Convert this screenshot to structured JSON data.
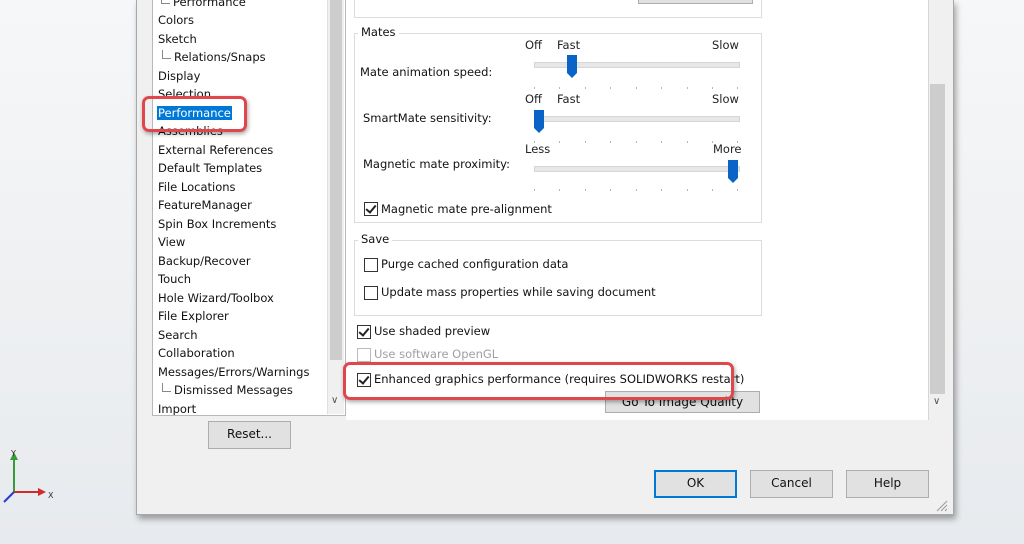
{
  "tree": {
    "items": [
      {
        "label": "Performance",
        "indent": true
      },
      {
        "label": "Colors",
        "indent": false
      },
      {
        "label": "Sketch",
        "indent": false
      },
      {
        "label": "Relations/Snaps",
        "indent": true
      },
      {
        "label": "Display",
        "indent": false
      },
      {
        "label": "Selection",
        "indent": false
      },
      {
        "label": "Performance",
        "indent": false,
        "selected": true
      },
      {
        "label": "Assemblies",
        "indent": false
      },
      {
        "label": "External References",
        "indent": false
      },
      {
        "label": "Default Templates",
        "indent": false
      },
      {
        "label": "File Locations",
        "indent": false
      },
      {
        "label": "FeatureManager",
        "indent": false
      },
      {
        "label": "Spin Box Increments",
        "indent": false
      },
      {
        "label": "View",
        "indent": false
      },
      {
        "label": "Backup/Recover",
        "indent": false
      },
      {
        "label": "Touch",
        "indent": false
      },
      {
        "label": "Hole Wizard/Toolbox",
        "indent": false
      },
      {
        "label": "File Explorer",
        "indent": false
      },
      {
        "label": "Search",
        "indent": false
      },
      {
        "label": "Collaboration",
        "indent": false
      },
      {
        "label": "Messages/Errors/Warnings",
        "indent": false
      },
      {
        "label": "Dismissed Messages",
        "indent": true
      },
      {
        "label": "Import",
        "indent": false
      }
    ]
  },
  "reset_label": "Reset...",
  "mates": {
    "title": "Mates",
    "animation_label": "Mate animation speed:",
    "animation_off": "Off",
    "animation_fast": "Fast",
    "animation_slow": "Slow",
    "animation_level": 0.2,
    "smartmate_label": "SmartMate sensitivity:",
    "smartmate_off": "Off",
    "smartmate_fast": "Fast",
    "smartmate_slow": "Slow",
    "smartmate_level": 0.0,
    "magnetic_label": "Magnetic mate proximity:",
    "magnetic_less": "Less",
    "magnetic_more": "More",
    "magnetic_level": 1.0,
    "prealign_label": "Magnetic mate pre-alignment",
    "prealign_checked": true
  },
  "save": {
    "title": "Save",
    "purge_label": "Purge cached configuration data",
    "purge_checked": false,
    "update_label": "Update mass properties while saving document",
    "update_checked": false
  },
  "options": {
    "shaded_preview_label": "Use shaded preview",
    "shaded_preview_checked": true,
    "software_opengl_label": "Use software OpenGL",
    "software_opengl_checked": false,
    "enhanced_label": "Enhanced graphics performance (requires SOLIDWORKS restart)",
    "enhanced_checked": true,
    "image_quality_label": "Go To Image Quality"
  },
  "buttons": {
    "ok": "OK",
    "cancel": "Cancel",
    "help": "Help"
  },
  "triad": {
    "y": "Y",
    "x": "X"
  },
  "colors": {
    "accent": "#0078d7",
    "slider": "#0a64c8",
    "callout": "#e0474c"
  }
}
